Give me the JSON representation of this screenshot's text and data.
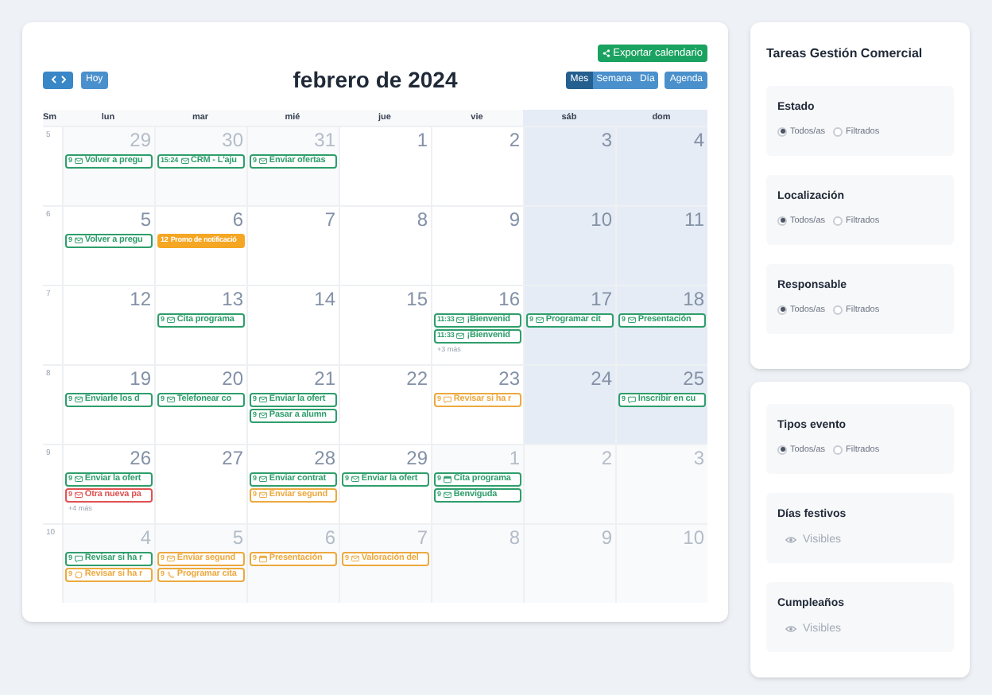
{
  "toolbar": {
    "export_button": "Exportar calendario",
    "today_button": "Hoy",
    "title": "febrero de 2024",
    "views": [
      {
        "label": "Mes",
        "selected": true
      },
      {
        "label": "Semana",
        "selected": false
      },
      {
        "label": "Día",
        "selected": false
      }
    ],
    "agenda_button": "Agenda"
  },
  "calendar": {
    "week_label": "Sm",
    "weekdays": [
      {
        "label": "lun",
        "weekend": false
      },
      {
        "label": "mar",
        "weekend": false
      },
      {
        "label": "mié",
        "weekend": false
      },
      {
        "label": "jue",
        "weekend": false
      },
      {
        "label": "vie",
        "weekend": false
      },
      {
        "label": "sáb",
        "weekend": true
      },
      {
        "label": "dom",
        "weekend": true
      }
    ],
    "weeks": [
      {
        "number": "5",
        "days": [
          {
            "day": "29",
            "in_month": false,
            "events": [
              {
                "time": "9",
                "kind": "mail",
                "title": "Volver a pregu",
                "color": "#2e9e6b"
              }
            ]
          },
          {
            "day": "30",
            "in_month": false,
            "events": [
              {
                "time": "15:24",
                "kind": "mail",
                "title": "CRM - L'aju",
                "color": "#2e9e6b"
              }
            ]
          },
          {
            "day": "31",
            "in_month": false,
            "events": [
              {
                "time": "9",
                "kind": "mail",
                "title": "Enviar ofertas",
                "color": "#2e9e6b"
              }
            ]
          },
          {
            "day": "1",
            "in_month": true
          },
          {
            "day": "2",
            "in_month": true
          },
          {
            "day": "3",
            "in_month": true
          },
          {
            "day": "4",
            "in_month": true
          }
        ]
      },
      {
        "number": "6",
        "days": [
          {
            "day": "5",
            "in_month": true,
            "events": [
              {
                "time": "9",
                "kind": "mail",
                "title": "Volver a pregu",
                "color": "#2e9e6b"
              }
            ]
          },
          {
            "day": "6",
            "in_month": true,
            "events": [
              {
                "time": "12",
                "kind": "banner",
                "title": "Promo de notificació",
                "color": "#f5a623"
              }
            ]
          },
          {
            "day": "7",
            "in_month": true
          },
          {
            "day": "8",
            "in_month": true
          },
          {
            "day": "9",
            "in_month": true
          },
          {
            "day": "10",
            "in_month": true
          },
          {
            "day": "11",
            "in_month": true
          }
        ]
      },
      {
        "number": "7",
        "days": [
          {
            "day": "12",
            "in_month": true
          },
          {
            "day": "13",
            "in_month": true,
            "events": [
              {
                "time": "9",
                "kind": "mail",
                "title": "Cita programa",
                "color": "#2e9e6b"
              }
            ]
          },
          {
            "day": "14",
            "in_month": true
          },
          {
            "day": "15",
            "in_month": true
          },
          {
            "day": "16",
            "in_month": true,
            "events": [
              {
                "time": "11:33",
                "kind": "mail",
                "title": "¡Bienvenid",
                "color": "#2e9e6b"
              },
              {
                "time": "11:33",
                "kind": "mail",
                "title": "¡Bienvenid",
                "color": "#2e9e6b"
              }
            ],
            "more": "+3 más"
          },
          {
            "day": "17",
            "in_month": true,
            "events": [
              {
                "time": "9",
                "kind": "mail",
                "title": "Programar cit",
                "color": "#2e9e6b"
              }
            ]
          },
          {
            "day": "18",
            "in_month": true,
            "events": [
              {
                "time": "9",
                "kind": "mail",
                "title": "Presentación",
                "color": "#2e9e6b"
              }
            ]
          }
        ]
      },
      {
        "number": "8",
        "days": [
          {
            "day": "19",
            "in_month": true,
            "events": [
              {
                "time": "9",
                "kind": "mail",
                "title": "Enviarle los d",
                "color": "#2e9e6b"
              }
            ]
          },
          {
            "day": "20",
            "in_month": true,
            "events": [
              {
                "time": "9",
                "kind": "mail",
                "title": "Telefonear co",
                "color": "#2e9e6b"
              }
            ]
          },
          {
            "day": "21",
            "in_month": true,
            "events": [
              {
                "time": "9",
                "kind": "mail",
                "title": "Enviar la ofert",
                "color": "#2e9e6b"
              },
              {
                "time": "9",
                "kind": "mail",
                "title": "Pasar a alumn",
                "color": "#2e9e6b"
              }
            ]
          },
          {
            "day": "22",
            "in_month": true
          },
          {
            "day": "23",
            "in_month": true,
            "events": [
              {
                "time": "9",
                "kind": "chat",
                "title": "Revisar si ha r",
                "color": "#eca93e"
              }
            ]
          },
          {
            "day": "24",
            "in_month": true
          },
          {
            "day": "25",
            "in_month": true,
            "events": [
              {
                "time": "9",
                "kind": "chat",
                "title": "Inscribir en cu",
                "color": "#2e9e6b"
              }
            ]
          }
        ]
      },
      {
        "number": "9",
        "days": [
          {
            "day": "26",
            "in_month": true,
            "events": [
              {
                "time": "9",
                "kind": "mail",
                "title": "Enviar la ofert",
                "color": "#2e9e6b"
              },
              {
                "time": "9",
                "kind": "mail",
                "title": "Otra nueva pa",
                "color": "#e05252"
              }
            ],
            "more": "+4 más"
          },
          {
            "day": "27",
            "in_month": true
          },
          {
            "day": "28",
            "in_month": true,
            "events": [
              {
                "time": "9",
                "kind": "mail",
                "title": "Enviar contrat",
                "color": "#2e9e6b"
              },
              {
                "time": "9",
                "kind": "mail",
                "title": "Enviar segund",
                "color": "#eca93e"
              }
            ]
          },
          {
            "day": "29",
            "in_month": true,
            "events": [
              {
                "time": "9",
                "kind": "mail",
                "title": "Enviar la ofert",
                "color": "#2e9e6b"
              }
            ]
          },
          {
            "day": "1",
            "in_month": false,
            "events": [
              {
                "time": "9",
                "kind": "calendar",
                "title": "Cita programa",
                "color": "#2e9e6b"
              },
              {
                "time": "9",
                "kind": "mail",
                "title": "Benviguda",
                "color": "#2e9e6b"
              }
            ]
          },
          {
            "day": "2",
            "in_month": false
          },
          {
            "day": "3",
            "in_month": false
          }
        ]
      },
      {
        "number": "10",
        "days": [
          {
            "day": "4",
            "in_month": false,
            "events": [
              {
                "time": "9",
                "kind": "chat",
                "title": "Revisar si ha r",
                "color": "#2e9e6b"
              },
              {
                "time": "9",
                "kind": "whatsapp",
                "title": "Revisar si ha r",
                "color": "#eca93e"
              }
            ]
          },
          {
            "day": "5",
            "in_month": false,
            "events": [
              {
                "time": "9",
                "kind": "mail",
                "title": "Enviar segund",
                "color": "#eca93e"
              },
              {
                "time": "9",
                "kind": "phone",
                "title": "Programar cita",
                "color": "#eca93e"
              }
            ]
          },
          {
            "day": "6",
            "in_month": false,
            "events": [
              {
                "time": "9",
                "kind": "calendar",
                "title": "Presentación",
                "color": "#eca93e"
              }
            ]
          },
          {
            "day": "7",
            "in_month": false,
            "events": [
              {
                "time": "9",
                "kind": "mail",
                "title": "Valoración del",
                "color": "#eca93e"
              }
            ]
          },
          {
            "day": "8",
            "in_month": false
          },
          {
            "day": "9",
            "in_month": false
          },
          {
            "day": "10",
            "in_month": false
          }
        ]
      }
    ]
  },
  "filter_panels": [
    {
      "title": "Tareas Gestión Comercial",
      "sections": [
        {
          "kind": "radio",
          "title": "Estado",
          "options": [
            {
              "label": "Todos/as",
              "selected": true
            },
            {
              "label": "Filtrados",
              "selected": false
            }
          ]
        },
        {
          "kind": "radio",
          "title": "Localización",
          "options": [
            {
              "label": "Todos/as",
              "selected": true
            },
            {
              "label": "Filtrados",
              "selected": false
            }
          ]
        },
        {
          "kind": "radio",
          "title": "Responsable",
          "options": [
            {
              "label": "Todos/as",
              "selected": true
            },
            {
              "label": "Filtrados",
              "selected": false
            }
          ]
        }
      ]
    },
    {
      "sections": [
        {
          "kind": "radio",
          "title": "Tipos evento",
          "options": [
            {
              "label": "Todos/as",
              "selected": true
            },
            {
              "label": "Filtrados",
              "selected": false
            }
          ]
        },
        {
          "kind": "visibility",
          "title": "Días festivos",
          "label": "Visibles"
        },
        {
          "kind": "visibility",
          "title": "Cumpleaños",
          "label": "Visibles"
        }
      ]
    }
  ]
}
